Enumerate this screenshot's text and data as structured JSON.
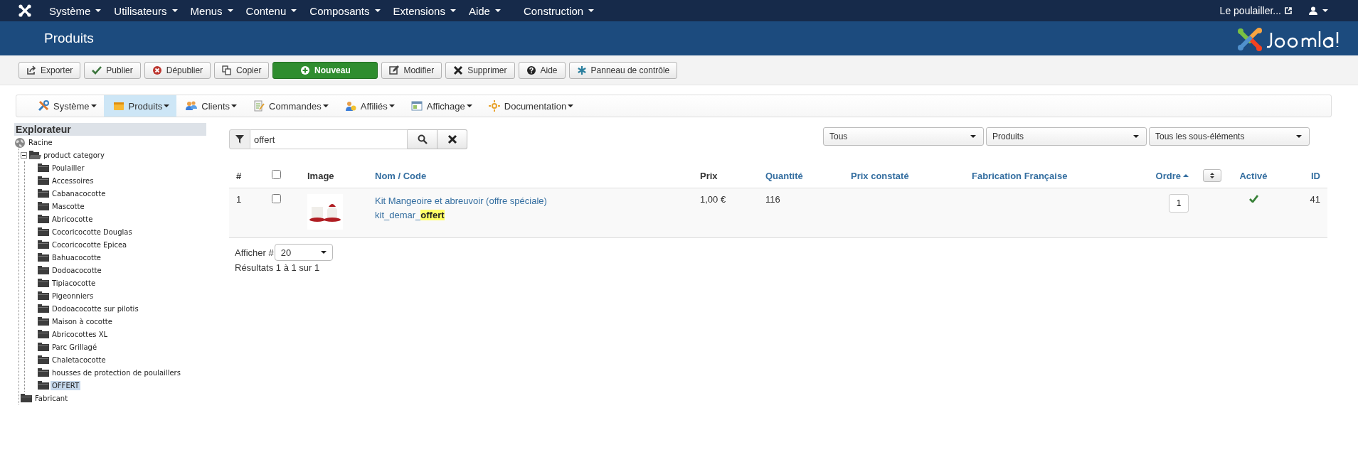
{
  "top_menu": {
    "items": [
      {
        "label": "Système"
      },
      {
        "label": "Utilisateurs"
      },
      {
        "label": "Menus"
      },
      {
        "label": "Contenu"
      },
      {
        "label": "Composants"
      },
      {
        "label": "Extensions"
      },
      {
        "label": "Aide"
      },
      {
        "label": "Construction"
      }
    ],
    "site_link": "Le poulailler..."
  },
  "header": {
    "title": "Produits"
  },
  "toolbar": [
    {
      "label": "Exporter",
      "kind": "default"
    },
    {
      "label": "Publier",
      "kind": "default"
    },
    {
      "label": "Dépublier",
      "kind": "default"
    },
    {
      "label": "Copier",
      "kind": "default"
    },
    {
      "label": "Nouveau",
      "kind": "primary"
    },
    {
      "label": "Modifier",
      "kind": "default"
    },
    {
      "label": "Supprimer",
      "kind": "default"
    },
    {
      "label": "Aide",
      "kind": "default"
    },
    {
      "label": "Panneau de contrôle",
      "kind": "default"
    }
  ],
  "component_menu": [
    {
      "label": "Système",
      "selected": false
    },
    {
      "label": "Produits",
      "selected": true
    },
    {
      "label": "Clients",
      "selected": false
    },
    {
      "label": "Commandes",
      "selected": false
    },
    {
      "label": "Affiliés",
      "selected": false
    },
    {
      "label": "Affichage",
      "selected": false
    },
    {
      "label": "Documentation",
      "selected": false
    }
  ],
  "explorer": {
    "title": "Explorateur",
    "tree": [
      {
        "label": "Racine",
        "selected": false,
        "children": [
          {
            "label": "product category",
            "selected": false,
            "expanded": true,
            "children": [
              {
                "label": "Poulailler",
                "selected": false
              },
              {
                "label": "Accessoires",
                "selected": false
              },
              {
                "label": "Cabanacocotte",
                "selected": false
              },
              {
                "label": "Mascotte",
                "selected": false
              },
              {
                "label": "Abricocotte",
                "selected": false
              },
              {
                "label": "Cocoricocotte Douglas",
                "selected": false
              },
              {
                "label": "Cocoricocotte Epicea",
                "selected": false
              },
              {
                "label": "Bahuacocotte",
                "selected": false
              },
              {
                "label": "Dodoacocotte",
                "selected": false
              },
              {
                "label": "Tipiacocotte",
                "selected": false
              },
              {
                "label": "Pigeonniers",
                "selected": false
              },
              {
                "label": "Dodoacocotte sur pilotis",
                "selected": false
              },
              {
                "label": "Maison à cocotte",
                "selected": false
              },
              {
                "label": "Abricocottes XL",
                "selected": false
              },
              {
                "label": "Parc Grillagé",
                "selected": false
              },
              {
                "label": "Chaletacocotte",
                "selected": false
              },
              {
                "label": "housses de protection de poulaillers",
                "selected": false
              },
              {
                "label": "OFFERT",
                "selected": true
              }
            ]
          },
          {
            "label": "Fabricant",
            "selected": false
          }
        ]
      }
    ]
  },
  "search": {
    "value": "offert"
  },
  "filters": [
    {
      "value": "Tous"
    },
    {
      "value": "Produits"
    },
    {
      "value": "Tous les sous-éléments"
    }
  ],
  "table": {
    "columns": [
      {
        "label": "#",
        "kind": "plain"
      },
      {
        "kind": "checkbox",
        "checked": false
      },
      {
        "label": "Image",
        "kind": "plain"
      },
      {
        "label": "Nom / Code",
        "kind": "link",
        "sorted": false
      },
      {
        "label": "Prix",
        "kind": "plain"
      },
      {
        "label": "Quantité",
        "kind": "link",
        "sorted": false
      },
      {
        "label": "Prix constaté",
        "kind": "link",
        "sorted": false
      },
      {
        "label": "Fabrication Française",
        "kind": "link",
        "sorted": false
      },
      {
        "label": "Ordre",
        "kind": "link",
        "sorted": true
      },
      {
        "kind": "sort-toggle"
      },
      {
        "label": "Activé",
        "kind": "link",
        "sorted": false
      },
      {
        "label": "ID",
        "kind": "link",
        "sorted": false
      }
    ],
    "rows": [
      {
        "number": "1",
        "checked": false,
        "name": "Kit Mangeoire et abreuvoir (offre spéciale)",
        "code": "kit_demar_**offert**",
        "price": "1,00 €",
        "quantity": "116",
        "order": "1",
        "active": true,
        "id": "41"
      }
    ]
  },
  "pagination": {
    "label": "Afficher #",
    "value": "20",
    "results": "Résultats 1 à 1 sur 1"
  }
}
